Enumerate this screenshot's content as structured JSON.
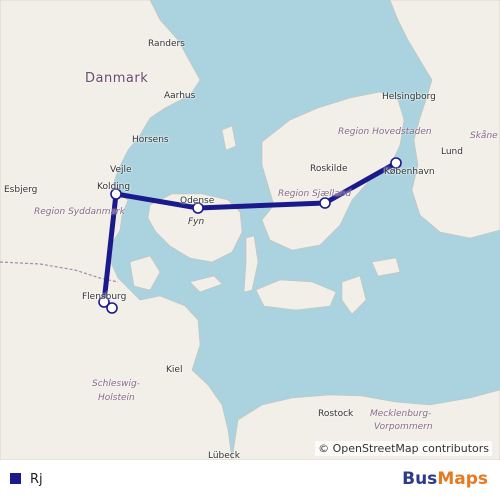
{
  "map": {
    "country_label": "Danmark",
    "cities": {
      "randers": "Randers",
      "aarhus": "Aarhus",
      "horsens": "Horsens",
      "vejle": "Vejle",
      "kolding": "Kolding",
      "esbjerg": "Esbjerg",
      "odense": "Odense",
      "fyn": "Fyn",
      "flensburg": "Flensburg",
      "kiel": "Kiel",
      "roskilde": "Roskilde",
      "kobenhavn": "København",
      "helsingborg": "Helsingborg",
      "lund": "Lund",
      "skane": "Skåne",
      "rostock": "Rostock",
      "lubeck": "Lübeck"
    },
    "regions": {
      "syddanmark": "Region Syddanmark",
      "sjaelland": "Region Sjælland",
      "hovedstaden": "Region Hovedstaden",
      "schleswig": "Schleswig-",
      "holstein": "Holstein",
      "mecklenburg": "Mecklenburg-",
      "vorpommern": "Vorpommern"
    },
    "route_color": "#1a1a8c",
    "attribution": "© OpenStreetMap contributors"
  },
  "legend": {
    "route_name": "Rj",
    "route_color": "#1a1a8c"
  },
  "brand": {
    "part1": "Bus",
    "part2": "Maps",
    "color1": "#2a3a8c",
    "color2": "#e8791e"
  }
}
